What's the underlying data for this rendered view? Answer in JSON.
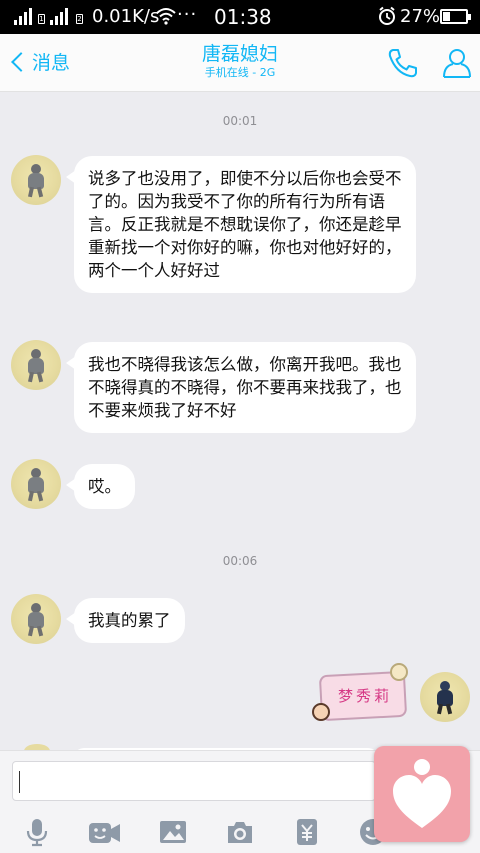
{
  "status_bar": {
    "network_speed": "0.01K/s",
    "time": "01:38",
    "battery": "27%"
  },
  "header": {
    "back_label": "消息",
    "contact_name": "唐磊媳妇",
    "contact_status": "手机在线 - 2G"
  },
  "chat": {
    "timestamps": [
      "00:01",
      "00:06"
    ],
    "messages": [
      "说多了也没用了，即使不分以后你也会受不了的。因为我受不了你的所有行为所有语言。反正我就是不想耽误你了，你还是趁早重新找一个对你好的嘛，你也对他好好的，两个一个人好好过",
      "我也不晓得我该怎么做，你离开我吧。我也不晓得真的不晓得，你不要再来找我了，也不要来烦我了好不好",
      "哎。",
      "我真的累了"
    ],
    "sticker_text": "梦秀莉"
  },
  "input": {
    "value": "",
    "placeholder": ""
  },
  "icons": {
    "back": "chevron-left-icon",
    "call": "phone-icon",
    "profile": "person-icon",
    "voice": "microphone-icon",
    "video": "video-face-icon",
    "image": "image-icon",
    "camera": "camera-icon",
    "red_packet": "red-packet-icon",
    "emoji": "emoji-icon",
    "floating": "heart-icon"
  },
  "colors": {
    "accent": "#12b7f5",
    "chat_background": "#ececf0",
    "bubble": "#ffffff",
    "floating_button": "#f2a2aa"
  }
}
